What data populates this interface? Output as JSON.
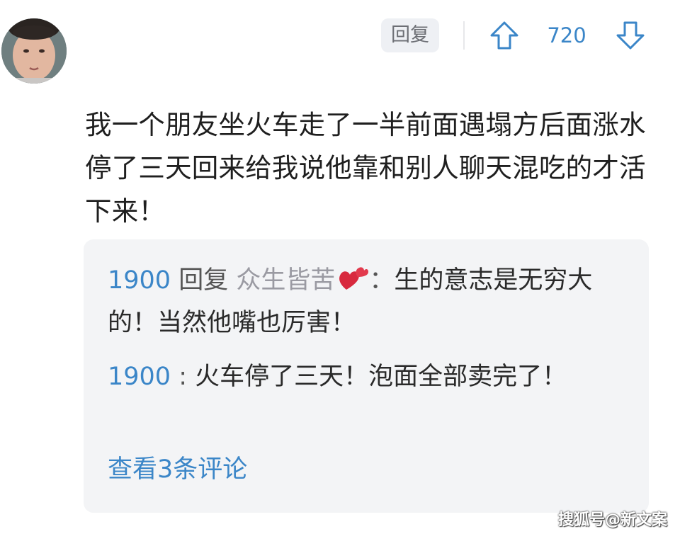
{
  "header": {
    "reply_label": "回复",
    "vote_count": "720",
    "upvote_icon": "arrow-up-icon",
    "downvote_icon": "arrow-down-icon"
  },
  "comment": {
    "text": "我一个朋友坐火车走了一半前面遇塌方后面涨水停了三天回来给我说他靠和别人聊天混吃的才活下来！"
  },
  "replies": {
    "items": [
      {
        "user": "1900",
        "verb": "回复",
        "target": "众生皆苦",
        "separator": "：",
        "text": "生的意志是无穷大的！当然他嘴也厉害！"
      },
      {
        "user": "1900",
        "separator": " : ",
        "text": "火车停了三天！泡面全部卖完了！"
      }
    ],
    "view_more": "查看3条评论"
  },
  "watermark": "搜狐号@新文案",
  "colors": {
    "accent": "#3b86c8",
    "reply_box_bg": "#f3f4f6",
    "reply_button_bg": "#eef0f4"
  }
}
